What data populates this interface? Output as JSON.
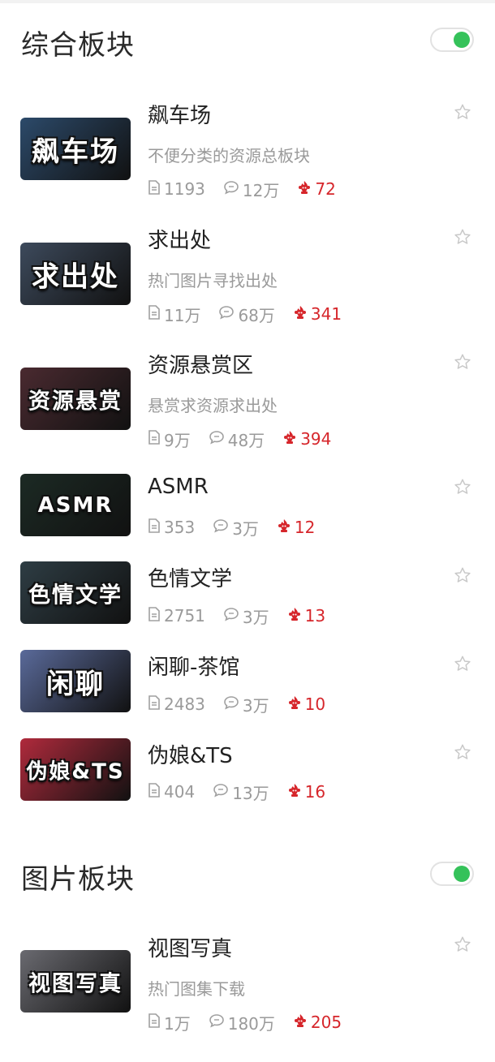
{
  "sections": [
    {
      "title": "综合板块",
      "enabled": true,
      "items": [
        {
          "name": "飙车场",
          "desc": "不便分类的资源总板块",
          "posts": "1193",
          "comments": "12万",
          "heat": "72",
          "thumb_text": "飙车场",
          "thumb_color": "#2c4a6a"
        },
        {
          "name": "求出处",
          "desc": "热门图片寻找出处",
          "posts": "11万",
          "comments": "68万",
          "heat": "341",
          "thumb_text": "求出处",
          "thumb_color": "#3d4a5c"
        },
        {
          "name": "资源悬赏区",
          "desc": "悬赏求资源求出处",
          "posts": "9万",
          "comments": "48万",
          "heat": "394",
          "thumb_text": "资源悬赏",
          "thumb_color": "#4a2a30"
        },
        {
          "name": "ASMR",
          "desc": "",
          "posts": "353",
          "comments": "3万",
          "heat": "12",
          "thumb_text": "ASMR",
          "thumb_color": "#1c2a24"
        },
        {
          "name": "色情文学",
          "desc": "",
          "posts": "2751",
          "comments": "3万",
          "heat": "13",
          "thumb_text": "色情文学",
          "thumb_color": "#2e3d44"
        },
        {
          "name": "闲聊-茶馆",
          "desc": "",
          "posts": "2483",
          "comments": "3万",
          "heat": "10",
          "thumb_text": "闲聊",
          "thumb_color": "#5a6a9a"
        },
        {
          "name": "伪娘&TS",
          "desc": "",
          "posts": "404",
          "comments": "13万",
          "heat": "16",
          "thumb_text": "伪娘&TS",
          "thumb_color": "#b02a3c"
        }
      ]
    },
    {
      "title": "图片板块",
      "enabled": true,
      "items": [
        {
          "name": "视图写真",
          "desc": "热门图集下载",
          "posts": "1万",
          "comments": "180万",
          "heat": "205",
          "thumb_text": "视图写真",
          "thumb_color": "#6a6a70"
        }
      ]
    }
  ],
  "colors": {
    "accent_toggle": "#35c25a",
    "heat_red": "#d6262b",
    "muted": "#9a9a9a"
  },
  "icons": {
    "posts": "document-icon",
    "comments": "comment-bubble-icon",
    "heat": "heat-icon",
    "favorite": "star-outline-icon"
  }
}
